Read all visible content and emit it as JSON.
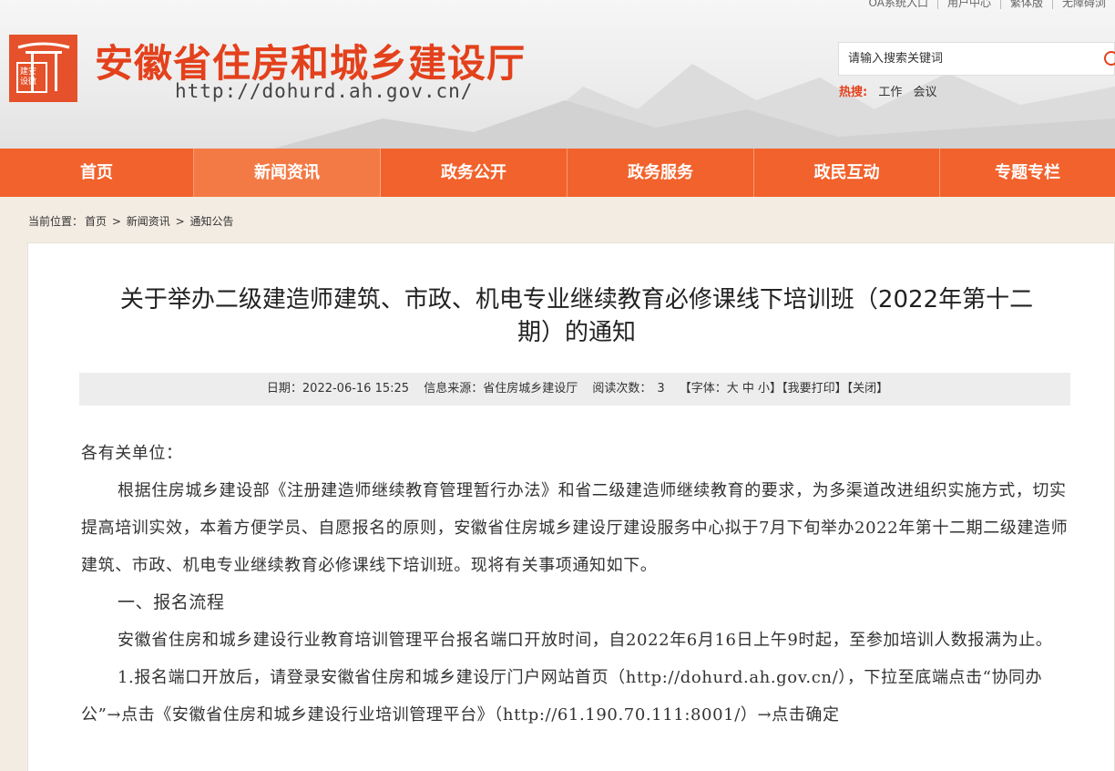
{
  "header": {
    "top_links": [
      "OA系统入口",
      "用户中心",
      "繁体版",
      "无障碍浏"
    ],
    "logo_seal_text": "建安设徽",
    "site_title": "安徽省住房和城乡建设厅",
    "site_url": "http://dohurd.ah.gov.cn/",
    "search_placeholder": "请输入搜索关键词",
    "hot_label": "热搜:",
    "hot_keywords": [
      "工作",
      "会议"
    ]
  },
  "nav": {
    "items": [
      "首页",
      "新闻资讯",
      "政务公开",
      "政务服务",
      "政民互动",
      "专题专栏"
    ],
    "active_index": 1
  },
  "breadcrumb": {
    "label": "当前位置：",
    "items": [
      "首页",
      "新闻资讯",
      "通知公告"
    ],
    "separator": ">"
  },
  "article": {
    "title_line1": "关于举办二级建造师建筑、市政、机电专业继续教育必修课线下培训班（2022年第十二",
    "title_line2": "期）的通知",
    "meta": {
      "date": "日期：2022-06-16 15:25",
      "source": "信息来源：省住房城乡建设厅",
      "views_label": "阅读次数：",
      "views": "3",
      "font_size": "【字体：大 中 小】",
      "print": "【我要打印】",
      "close": "【关闭】"
    },
    "greeting": "各有关单位：",
    "para1": "根据住房城乡建设部《注册建造师继续教育管理暂行办法》和省二级建造师继续教育的要求，为多渠道改进组织实施方式，切实提高培训实效，本着方便学员、自愿报名的原则，安徽省住房城乡建设厅建设服务中心拟于7月下旬举办2022年第十二期二级建造师建筑、市政、机电专业继续教育必修课线下培训班。现将有关事项通知如下。",
    "section1": "一、报名流程",
    "para2": "安徽省住房和城乡建设行业教育培训管理平台报名端口开放时间，自2022年6月16日上午9时起，至参加培训人数报满为止。",
    "para3": "1.报名端口开放后，请登录安徽省住房和城乡建设厅门户网站首页（http://dohurd.ah.gov.cn/），下拉至底端点击“协同办公”→点击《安徽省住房和城乡建设行业培训管理平台》（http://61.190.70.111:8001/）→点击确定"
  }
}
